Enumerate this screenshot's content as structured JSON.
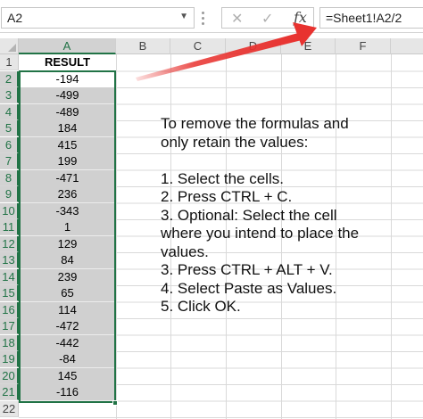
{
  "formula_bar": {
    "name_box": "A2",
    "cancel_icon": "close-icon",
    "enter_icon": "check-icon",
    "function_label": "fx",
    "formula": "=Sheet1!A2/2"
  },
  "grid": {
    "columns": [
      "A",
      "B",
      "C",
      "D",
      "E",
      "F"
    ],
    "rows": [
      "1",
      "2",
      "3",
      "4",
      "5",
      "6",
      "7",
      "8",
      "9",
      "10",
      "11",
      "12",
      "13",
      "14",
      "15",
      "16",
      "17",
      "18",
      "19",
      "20",
      "21",
      "22"
    ],
    "column_a": {
      "header": "RESULT",
      "values": [
        "-194",
        "-499",
        "-489",
        "184",
        "415",
        "199",
        "-471",
        "236",
        "-343",
        "1",
        "129",
        "84",
        "239",
        "65",
        "114",
        "-472",
        "-442",
        "-84",
        "145",
        "-116"
      ]
    },
    "selection": "A2:A21",
    "active_cell": "A2"
  },
  "instructions": {
    "intro": [
      "To remove the formulas and",
      "only retain the values:"
    ],
    "steps": [
      "1. Select the cells.",
      "2. Press CTRL + C.",
      "3. Optional: Select the cell",
      "where you intend to place the",
      "values.",
      "3. Press CTRL + ALT + V.",
      "4. Select Paste as Values.",
      "5. Click OK."
    ]
  },
  "colors": {
    "selection_border": "#217346",
    "selected_fill": "#d0d0d0",
    "arrow": "#e8322f"
  }
}
